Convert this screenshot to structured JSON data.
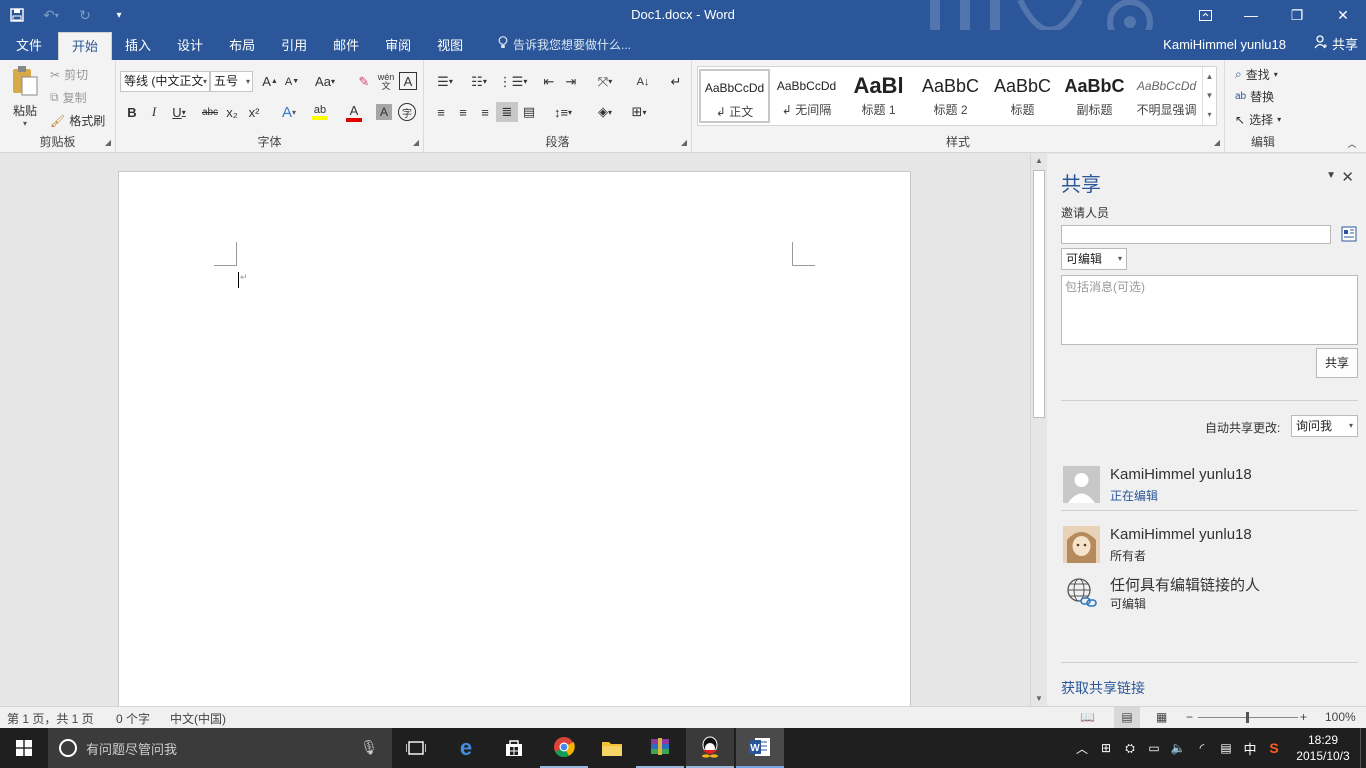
{
  "titlebar": {
    "doc_title": "Doc1.docx - Word"
  },
  "tabs": [
    {
      "label": "文件"
    },
    {
      "label": "开始"
    },
    {
      "label": "插入"
    },
    {
      "label": "设计"
    },
    {
      "label": "布局"
    },
    {
      "label": "引用"
    },
    {
      "label": "邮件"
    },
    {
      "label": "审阅"
    },
    {
      "label": "视图"
    }
  ],
  "tell_me": "告诉我您想要做什么...",
  "user_name": "KamiHimmel yunlu18",
  "share_label": "共享",
  "ribbon": {
    "clipboard": {
      "label": "剪贴板",
      "paste": "粘贴",
      "cut": "剪切",
      "copy": "复制",
      "format_painter": "格式刷"
    },
    "font": {
      "label": "字体",
      "font_name": "等线 (中文正文",
      "font_size": "五号",
      "aa": "Aa",
      "bold": "B",
      "italic": "I",
      "underline": "U",
      "strike": "abc",
      "subscript": "x₂",
      "superscript": "x²",
      "phonetic": "wén"
    },
    "paragraph": {
      "label": "段落"
    },
    "styles": {
      "label": "样式",
      "items": [
        {
          "preview": "AaBbCcDd",
          "name": "正文"
        },
        {
          "preview": "AaBbCcDd",
          "name": "无间隔"
        },
        {
          "preview": "AaBl",
          "name": "标题 1"
        },
        {
          "preview": "AaBbC",
          "name": "标题 2"
        },
        {
          "preview": "AaBbC",
          "name": "标题"
        },
        {
          "preview": "AaBbC",
          "name": "副标题"
        },
        {
          "preview": "AaBbCcDd",
          "name": "不明显强调"
        }
      ]
    },
    "editing": {
      "label": "编辑",
      "find": "查找",
      "replace": "替换",
      "select": "选择"
    }
  },
  "share_pane": {
    "title": "共享",
    "invite_label": "邀请人员",
    "permission": "可编辑",
    "message_placeholder": "包括消息(可选)",
    "share_button": "共享",
    "auto_share_label": "自动共享更改:",
    "auto_share_value": "询问我",
    "people": [
      {
        "name": "KamiHimmel yunlu18",
        "role": "正在编辑"
      },
      {
        "name": "KamiHimmel yunlu18",
        "role": "所有者"
      },
      {
        "name": "任何具有编辑链接的人",
        "role": "可编辑"
      }
    ],
    "get_link": "获取共享链接"
  },
  "statusbar": {
    "page": "第 1 页，共 1 页",
    "words": "0 个字",
    "language": "中文(中国)",
    "zoom": "100%"
  },
  "taskbar": {
    "search_placeholder": "有问题尽管问我",
    "time": "18:29",
    "date": "2015/10/3",
    "ime": "中"
  },
  "colors": {
    "accent": "#2b579a",
    "taskbar": "#1f1f1f"
  }
}
